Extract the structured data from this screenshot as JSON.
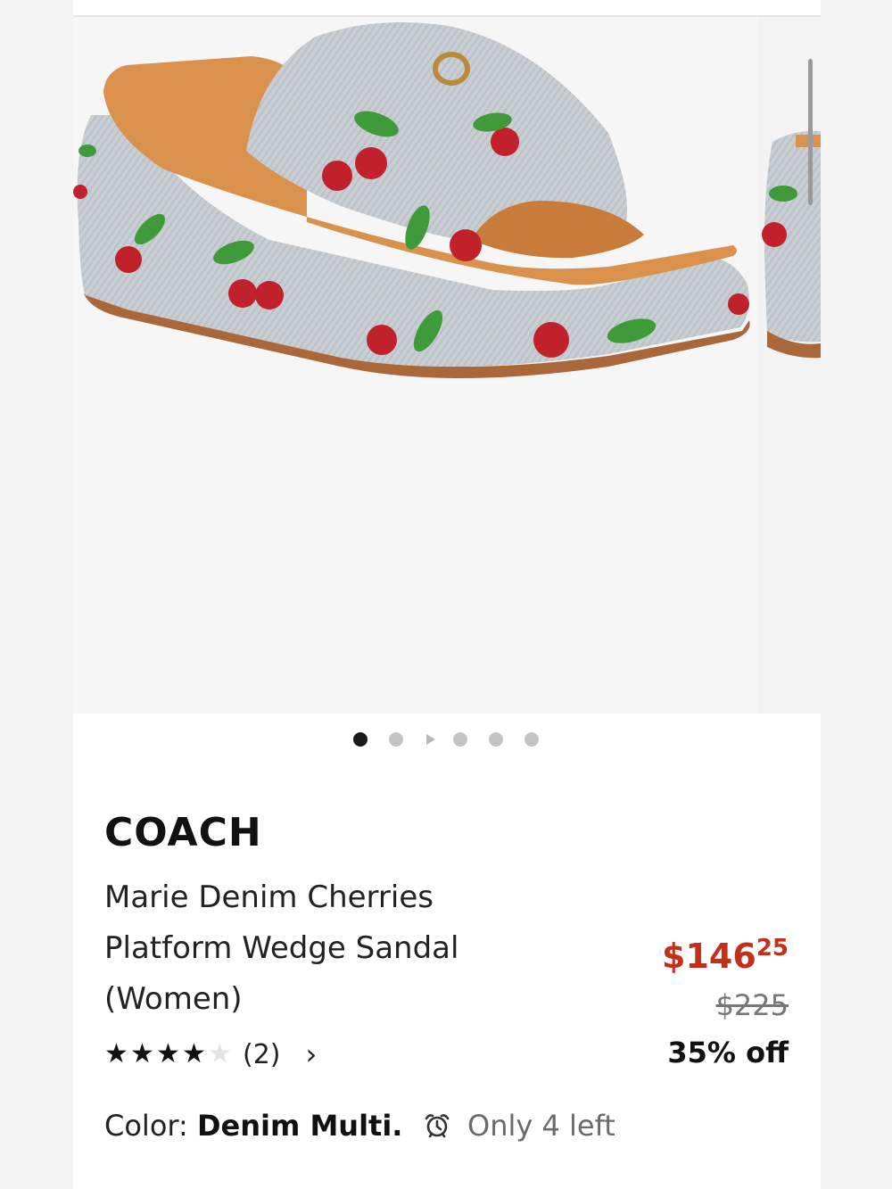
{
  "product": {
    "brand": "COACH",
    "title": "Marie Denim Cherries Platform Wedge Sandal (Women)",
    "image_alt": "Denim platform wedge sandal with embroidered cherries",
    "gallery": {
      "slide_count": 6,
      "active_index": 0,
      "video_index": 2
    }
  },
  "rating": {
    "stars": 4,
    "max": 5,
    "count_label": "(2)",
    "arrow": "›"
  },
  "pricing": {
    "sale_dollars": "$146",
    "sale_cents": "25",
    "original": "$225",
    "discount": "35% off",
    "sale_color": "#c42f1a"
  },
  "color": {
    "label": "Color:",
    "value": "Denim Multi."
  },
  "stock": {
    "icon": "alarm-clock-icon",
    "text": "Only 4 left"
  }
}
